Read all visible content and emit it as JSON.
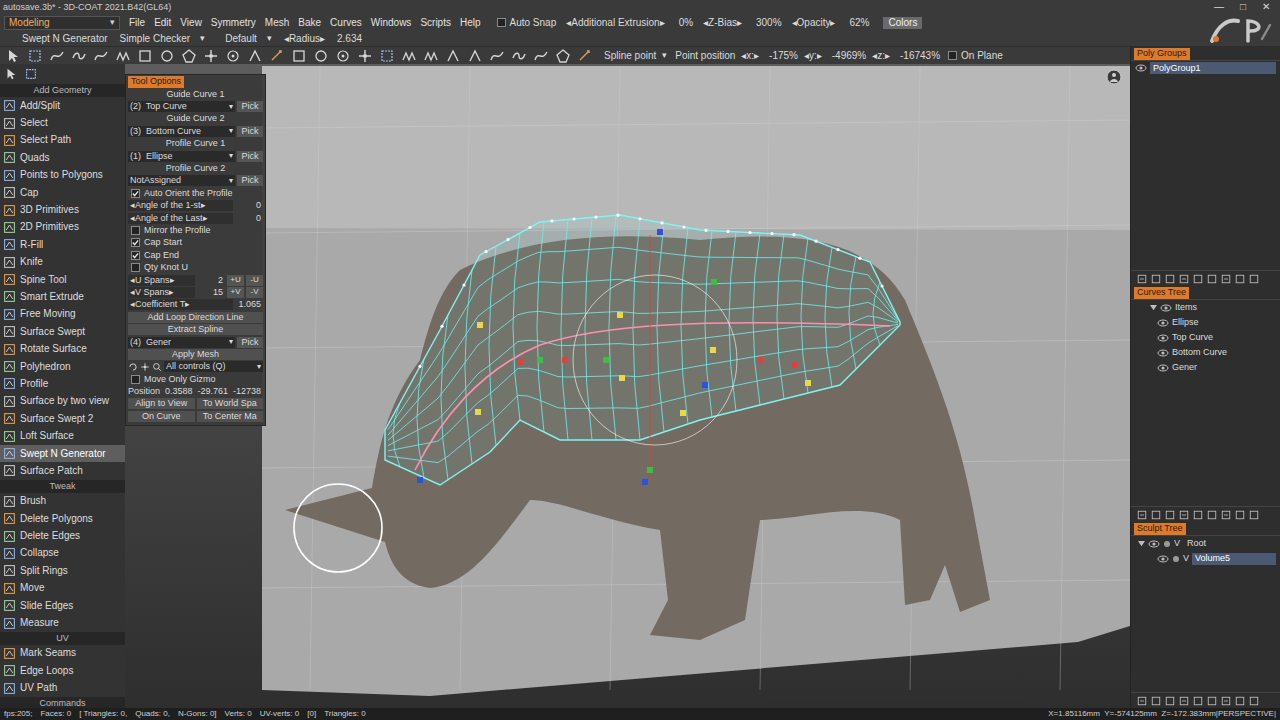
{
  "window": {
    "title": "autosave.3b* - 3D-COAT 2021.B42(GL64)",
    "controls": [
      "—",
      "□",
      "✕"
    ]
  },
  "menubar": {
    "room": "Modeling",
    "room_arrow": "▾",
    "menus": [
      "File",
      "Edit",
      "View",
      "Symmetry",
      "Mesh",
      "Bake",
      "Curves",
      "Windows",
      "Scripts",
      "Help"
    ],
    "auto_snap": {
      "label": "Auto Snap",
      "checked": false
    },
    "fields": [
      {
        "label": "◂Additional Extrusion▸",
        "value": "0%"
      },
      {
        "label": "◂Z-Bias▸",
        "value": "300%"
      },
      {
        "label": "◂Opacity▸",
        "value": "62%"
      }
    ],
    "colors_button": "Colors"
  },
  "toolbar2": {
    "tool": "Swept N Generator",
    "dropdowns": [
      {
        "label": "Simple Checker",
        "arrow": "▾"
      },
      {
        "label": "Default",
        "arrow": "▾"
      }
    ],
    "radius": {
      "label": "◂Radius▸",
      "value": "2.634"
    }
  },
  "toolbar3": {
    "mode": {
      "label": "Spline point",
      "arrow": "▾"
    },
    "position_label": "Point position",
    "coords": [
      {
        "label": "◂x:▸",
        "value": "-175%"
      },
      {
        "label": "◂y:▸",
        "value": "-4969%"
      },
      {
        "label": "◂z:▸",
        "value": "-16743%"
      }
    ],
    "on_plane": {
      "label": "On Plane",
      "checked": false
    }
  },
  "tools": {
    "sections": [
      {
        "title": "Add Geometry",
        "items": [
          {
            "label": "Add/Split",
            "selected": false
          },
          {
            "label": "Select",
            "selected": false
          },
          {
            "label": "Select Path",
            "selected": false
          },
          {
            "label": "Quads",
            "selected": false
          },
          {
            "label": "Points to Polygons",
            "selected": false
          },
          {
            "label": "Cap",
            "selected": false
          },
          {
            "label": "3D Primitives",
            "selected": false
          },
          {
            "label": "2D Primitives",
            "selected": false
          },
          {
            "label": "R-Fill",
            "selected": false
          },
          {
            "label": "Knife",
            "selected": false
          },
          {
            "label": "Spine Tool",
            "selected": false
          },
          {
            "label": "Smart Extrude",
            "selected": false
          },
          {
            "label": "Free Moving",
            "selected": false
          },
          {
            "label": "Surface Swept",
            "selected": false
          },
          {
            "label": "Rotate Surface",
            "selected": false
          },
          {
            "label": "Polyhedron",
            "selected": false
          },
          {
            "label": "Profile",
            "selected": false
          },
          {
            "label": "Surface by two view",
            "selected": false
          },
          {
            "label": "Surface Swept 2",
            "selected": false
          },
          {
            "label": "Loft Surface",
            "selected": false
          },
          {
            "label": "Swept N Generator",
            "selected": true
          },
          {
            "label": "Surface Patch",
            "selected": false
          }
        ]
      },
      {
        "title": "Tweak",
        "items": [
          {
            "label": "Brush",
            "selected": false
          },
          {
            "label": "Delete Polygons",
            "selected": false
          },
          {
            "label": "Delete Edges",
            "selected": false
          },
          {
            "label": "Collapse",
            "selected": false
          },
          {
            "label": "Split Rings",
            "selected": false
          },
          {
            "label": "Move",
            "selected": false
          },
          {
            "label": "Slide Edges",
            "selected": false
          },
          {
            "label": "Measure",
            "selected": false
          }
        ]
      },
      {
        "title": "UV",
        "items": [
          {
            "label": "Mark Seams",
            "selected": false
          },
          {
            "label": "Edge Loops",
            "selected": false
          },
          {
            "label": "UV Path",
            "selected": false
          }
        ]
      },
      {
        "title": "Commands",
        "items": []
      }
    ]
  },
  "tool_options": {
    "title": "Tool Options",
    "rows": [
      {
        "kind": "heading",
        "label": "Guide Curve 1"
      },
      {
        "kind": "dropdown",
        "value": "(2)  Top Curve",
        "arrow": "▾",
        "button": "Pick"
      },
      {
        "kind": "heading",
        "label": "Guide Curve 2"
      },
      {
        "kind": "dropdown",
        "value": "(3)  Bottom Curve",
        "arrow": "▾",
        "button": "Pick"
      },
      {
        "kind": "heading",
        "label": "Profile Curve 1"
      },
      {
        "kind": "dropdown",
        "value": "(1)  Ellipse",
        "arrow": "▾",
        "button": "Pick"
      },
      {
        "kind": "heading",
        "label": "Profile Curve 2"
      },
      {
        "kind": "dropdown",
        "value": "NotAssigned",
        "arrow": "▾",
        "button": "Pick"
      },
      {
        "kind": "checkbox",
        "label": "Auto Orient the Profile",
        "checked": true
      },
      {
        "kind": "spinner",
        "label": "◂Angle of the 1-st▸",
        "value": "0",
        "buttons": []
      },
      {
        "kind": "spinner",
        "label": "◂Angle of the Last▸",
        "value": "0",
        "buttons": []
      },
      {
        "kind": "checkbox",
        "label": "Mirror the Profile",
        "checked": false
      },
      {
        "kind": "checkbox",
        "label": "Cap Start",
        "checked": true
      },
      {
        "kind": "checkbox",
        "label": "Cap End",
        "checked": true
      },
      {
        "kind": "checkbox",
        "label": "Qty Knot U",
        "checked": false
      },
      {
        "kind": "spinner",
        "label": "◂U Spans▸",
        "value": "2",
        "buttons": [
          "+U",
          "-U"
        ]
      },
      {
        "kind": "spinner",
        "label": "◂V Spans▸",
        "value": "15",
        "buttons": [
          "+V",
          "-V"
        ]
      },
      {
        "kind": "spinner",
        "label": "◂Coefficient T▸",
        "value": "1.065",
        "buttons": []
      },
      {
        "kind": "button",
        "label": "Add Loop Direction Line"
      },
      {
        "kind": "button",
        "label": "Extract Spline"
      },
      {
        "kind": "dropdown",
        "value": "(4)  Gener",
        "arrow": "▾",
        "button": "Pick"
      },
      {
        "kind": "button",
        "label": "Apply Mesh"
      },
      {
        "kind": "controls",
        "value": "All controls (Q)",
        "arrow": "▾"
      },
      {
        "kind": "checkbox",
        "label": "Move Only Gizmo",
        "checked": false
      },
      {
        "kind": "position",
        "label": "Position",
        "values": [
          "0.3588",
          "-29.761",
          "-12738"
        ]
      },
      {
        "kind": "buttons",
        "buttons": [
          "Align to View",
          "To World Spa"
        ]
      },
      {
        "kind": "buttons",
        "buttons": [
          "On Curve",
          "To Center Ma"
        ]
      }
    ]
  },
  "poly_groups": {
    "title": "Poly Groups",
    "items": [
      {
        "label": "PolyGroup1",
        "selected": true
      }
    ]
  },
  "curves_tree": {
    "title": "Curves Tree",
    "root": {
      "label": "Items",
      "expanded": true,
      "children": [
        {
          "label": "Ellipse",
          "selected": false
        },
        {
          "label": "Top Curve",
          "selected": false
        },
        {
          "label": "Bottom Curve",
          "selected": false
        },
        {
          "label": "Gener",
          "selected": false
        }
      ]
    }
  },
  "sculpt_tree": {
    "title": "Sculpt Tree",
    "root": {
      "label": "Root",
      "prefix": "V",
      "expanded": true,
      "selected": false,
      "children": [
        {
          "label": "Volume5",
          "prefix": "V",
          "selected": true
        }
      ]
    }
  },
  "status_bar": {
    "left": [
      "fps:205;",
      "Faces: 0",
      "[ Triangles: 0,",
      "Quads: 0,",
      "N-Gons: 0]",
      "Verts: 0",
      "UV-verts: 0",
      "[0]",
      "Triangles: 0"
    ],
    "right": "X=1.85116mm  Y=-574125mm  Z=-172.383mm|PERSPECTIVE|"
  }
}
